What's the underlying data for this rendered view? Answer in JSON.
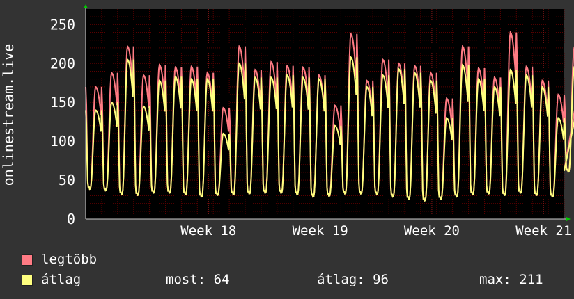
{
  "chart_data": {
    "type": "line",
    "ylabel": "onlinestream.live",
    "ylim": [
      0,
      270
    ],
    "yticks": [
      0,
      50,
      100,
      150,
      200,
      250
    ],
    "xlim": [
      0,
      30
    ],
    "xticks": [
      {
        "label": "Week 18",
        "x": 7.7
      },
      {
        "label": "Week 19",
        "x": 14.7
      },
      {
        "label": "Week 20",
        "x": 21.7
      },
      {
        "label": "Week 21",
        "x": 28.7
      }
    ],
    "days": [
      {
        "peak_max": 170,
        "peak_avg": 140,
        "trough": 40
      },
      {
        "peak_max": 188,
        "peak_avg": 150,
        "trough": 38
      },
      {
        "peak_max": 222,
        "peak_avg": 205,
        "trough": 33
      },
      {
        "peak_max": 185,
        "peak_avg": 145,
        "trough": 32
      },
      {
        "peak_max": 198,
        "peak_avg": 178,
        "trough": 35
      },
      {
        "peak_max": 195,
        "peak_avg": 183,
        "trough": 35
      },
      {
        "peak_max": 196,
        "peak_avg": 180,
        "trough": 33
      },
      {
        "peak_max": 188,
        "peak_avg": 180,
        "trough": 30
      },
      {
        "peak_max": 143,
        "peak_avg": 110,
        "trough": 32
      },
      {
        "peak_max": 222,
        "peak_avg": 200,
        "trough": 33
      },
      {
        "peak_max": 192,
        "peak_avg": 182,
        "trough": 34
      },
      {
        "peak_max": 202,
        "peak_avg": 182,
        "trough": 35
      },
      {
        "peak_max": 197,
        "peak_avg": 185,
        "trough": 35
      },
      {
        "peak_max": 195,
        "peak_avg": 182,
        "trough": 33
      },
      {
        "peak_max": 185,
        "peak_avg": 180,
        "trough": 30
      },
      {
        "peak_max": 146,
        "peak_avg": 120,
        "trough": 31
      },
      {
        "peak_max": 238,
        "peak_avg": 208,
        "trough": 34
      },
      {
        "peak_max": 178,
        "peak_avg": 170,
        "trough": 34
      },
      {
        "peak_max": 205,
        "peak_avg": 185,
        "trough": 33
      },
      {
        "peak_max": 200,
        "peak_avg": 193,
        "trough": 30
      },
      {
        "peak_max": 197,
        "peak_avg": 188,
        "trough": 27
      },
      {
        "peak_max": 188,
        "peak_avg": 178,
        "trough": 25
      },
      {
        "peak_max": 155,
        "peak_avg": 130,
        "trough": 27
      },
      {
        "peak_max": 222,
        "peak_avg": 198,
        "trough": 30
      },
      {
        "peak_max": 194,
        "peak_avg": 180,
        "trough": 33
      },
      {
        "peak_max": 182,
        "peak_avg": 170,
        "trough": 34
      },
      {
        "peak_max": 240,
        "peak_avg": 192,
        "trough": 32
      },
      {
        "peak_max": 196,
        "peak_avg": 185,
        "trough": 35
      },
      {
        "peak_max": 178,
        "peak_avg": 170,
        "trough": 32
      },
      {
        "peak_max": 160,
        "peak_avg": 130,
        "trough": 30
      },
      {
        "peak_max": 220,
        "peak_avg": 195,
        "trough": 62
      }
    ],
    "series": [
      {
        "name": "legtöbb",
        "color": "#ff7b84"
      },
      {
        "name": "átlag",
        "color": "#ffff7f"
      }
    ],
    "grid": true,
    "background": "#000000",
    "grid_color": "#5a0000"
  },
  "legend": {
    "items": [
      {
        "label": "legtöbb",
        "color": "#ff7b84"
      },
      {
        "label": "átlag",
        "color": "#ffff7f"
      }
    ],
    "stats": {
      "most": "most: 64",
      "atlag": "átlag: 96",
      "max": "max: 211"
    }
  }
}
